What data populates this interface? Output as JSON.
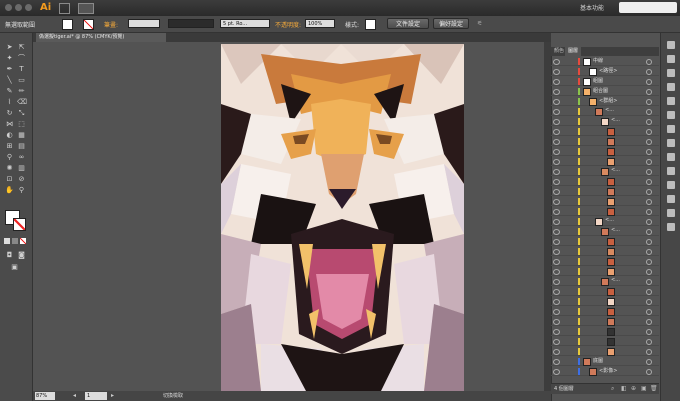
{
  "app": {
    "logo": "Ai",
    "workspace_label": "基本功能"
  },
  "control_bar": {
    "mode_label": "無選取範圍",
    "stroke_label": "筆畫:",
    "brush_value": "5 pt. Ro...",
    "opacity_label": "不透明度:",
    "opacity_value": "100%",
    "style_label": "樣式:",
    "doc_settings_button": "文件設定",
    "preferences_button": "偏好設定"
  },
  "document": {
    "tab_title": "偽選擬tiger.ai* @ 87% (CMYK/預覽)"
  },
  "status": {
    "zoom": "87%",
    "page": "1",
    "tool_label": "切換檢取"
  },
  "layers_panel": {
    "tabs": [
      "顏色",
      "圖層"
    ],
    "rows": [
      {
        "name": "中線",
        "depth": 0,
        "color": "#e64a3d",
        "thumb": "#ffffff"
      },
      {
        "name": "<路徑>",
        "depth": 1,
        "color": "#e64a3d",
        "thumb": "#ffffff"
      },
      {
        "name": "組圖",
        "depth": 0,
        "color": "#e64a3d",
        "thumb": "#ffffff"
      },
      {
        "name": "組合圖",
        "depth": 0,
        "color": "#8bc34a",
        "thumb": "#f4b06a"
      },
      {
        "name": "<群組>",
        "depth": 1,
        "color": "#8bc34a",
        "thumb": "#f4b06a"
      },
      {
        "name": "<...",
        "depth": 2,
        "color": "#e8c93a",
        "thumb": "#d07a5a"
      },
      {
        "name": "<...",
        "depth": 3,
        "color": "#e8c93a",
        "thumb": "#f3d7c6"
      },
      {
        "name": "",
        "depth": 4,
        "color": "#e8c93a",
        "thumb": "#c86040"
      },
      {
        "name": "",
        "depth": 4,
        "color": "#e8c93a",
        "thumb": "#d07a5a"
      },
      {
        "name": "",
        "depth": 4,
        "color": "#e8c93a",
        "thumb": "#c86040"
      },
      {
        "name": "",
        "depth": 4,
        "color": "#e8c93a",
        "thumb": "#eaa070"
      },
      {
        "name": "<...",
        "depth": 3,
        "color": "#e8c93a",
        "thumb": "#d88a60"
      },
      {
        "name": "",
        "depth": 4,
        "color": "#e8c93a",
        "thumb": "#c86040"
      },
      {
        "name": "",
        "depth": 4,
        "color": "#e8c93a",
        "thumb": "#d07a5a"
      },
      {
        "name": "",
        "depth": 4,
        "color": "#e8c93a",
        "thumb": "#eaa070"
      },
      {
        "name": "",
        "depth": 4,
        "color": "#e8c93a",
        "thumb": "#c86040"
      },
      {
        "name": "<...",
        "depth": 2,
        "color": "#e8c93a",
        "thumb": "#f3d7c6"
      },
      {
        "name": "<...",
        "depth": 3,
        "color": "#e8c93a",
        "thumb": "#d07a5a"
      },
      {
        "name": "",
        "depth": 4,
        "color": "#e8c93a",
        "thumb": "#c86040"
      },
      {
        "name": "",
        "depth": 4,
        "color": "#e8c93a",
        "thumb": "#d88a60"
      },
      {
        "name": "",
        "depth": 4,
        "color": "#e8c93a",
        "thumb": "#c86040"
      },
      {
        "name": "",
        "depth": 4,
        "color": "#e8c93a",
        "thumb": "#eaa070"
      },
      {
        "name": "<...",
        "depth": 3,
        "color": "#e8c93a",
        "thumb": "#d07a5a"
      },
      {
        "name": "",
        "depth": 4,
        "color": "#e8c93a",
        "thumb": "#c86040"
      },
      {
        "name": "",
        "depth": 4,
        "color": "#e8c93a",
        "thumb": "#f3d7c6"
      },
      {
        "name": "",
        "depth": 4,
        "color": "#e8c93a",
        "thumb": "#c86040"
      },
      {
        "name": "",
        "depth": 4,
        "color": "#e8c93a",
        "thumb": "#d07a5a"
      },
      {
        "name": "",
        "depth": 4,
        "color": "#e8c93a",
        "thumb": "#333333"
      },
      {
        "name": "",
        "depth": 4,
        "color": "#e8c93a",
        "thumb": "#333333"
      },
      {
        "name": "",
        "depth": 4,
        "color": "#e8c93a",
        "thumb": "#eaa070"
      },
      {
        "name": "底圖",
        "depth": 0,
        "color": "#3d6fe6",
        "thumb": "#d07a5a"
      },
      {
        "name": "<影像>",
        "depth": 1,
        "color": "#3d6fe6",
        "thumb": "#d07a5a"
      }
    ],
    "footer_count": "4 個圖層"
  }
}
